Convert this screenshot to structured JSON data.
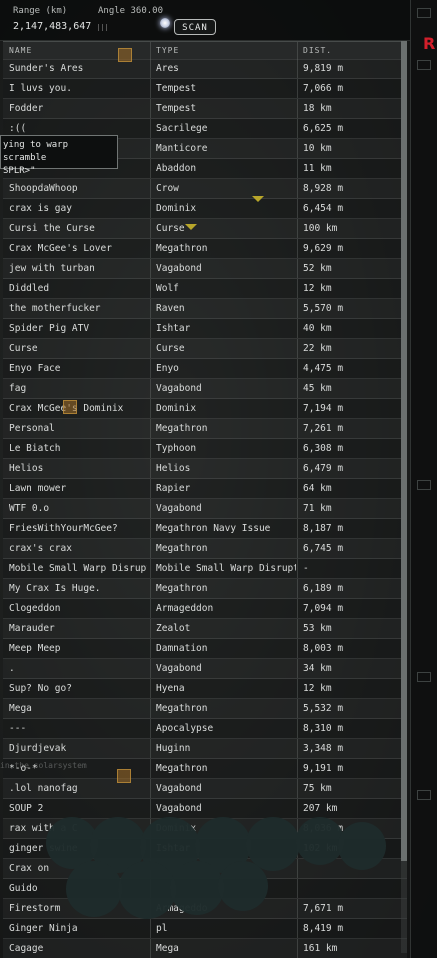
{
  "scanner": {
    "range_label": "Range (km)",
    "range_value": "2,147,483,647",
    "angle_label": "Angle 360.00",
    "scan_button": "SCAN"
  },
  "columns": {
    "name": "NAME",
    "type": "TYPE",
    "dist": "DIST."
  },
  "rows": [
    {
      "name": "Sunder's Ares",
      "type": "Ares",
      "dist": "9,819 m"
    },
    {
      "name": "I luvs you.",
      "type": "Tempest",
      "dist": "7,066 m"
    },
    {
      "name": "Fodder",
      "type": "Tempest",
      "dist": "18 km"
    },
    {
      "name": ":((",
      "type": "Sacrilege",
      "dist": "6,625 m"
    },
    {
      "name": "",
      "type": "Manticore",
      "dist": "10 km"
    },
    {
      "name": "",
      "type": "Abaddon",
      "dist": "11 km"
    },
    {
      "name": "ShoopdaWhoop",
      "type": "Crow",
      "dist": "8,928 m"
    },
    {
      "name": "crax is gay",
      "type": "Dominix",
      "dist": "6,454 m"
    },
    {
      "name": "Cursi the Curse",
      "type": "Curse",
      "dist": "100 km"
    },
    {
      "name": "Crax McGee's Lover",
      "type": "Megathron",
      "dist": "9,629 m"
    },
    {
      "name": "jew with turban",
      "type": "Vagabond",
      "dist": "52 km"
    },
    {
      "name": "Diddled",
      "type": "Wolf",
      "dist": "12 km"
    },
    {
      "name": "the motherfucker",
      "type": "Raven",
      "dist": "5,570 m"
    },
    {
      "name": "Spider Pig ATV",
      "type": "Ishtar",
      "dist": "40 km"
    },
    {
      "name": "Curse",
      "type": "Curse",
      "dist": "22 km"
    },
    {
      "name": "Enyo Face",
      "type": "Enyo",
      "dist": "4,475 m"
    },
    {
      "name": "fag",
      "type": "Vagabond",
      "dist": "45 km"
    },
    {
      "name": "Crax McGee's Dominix",
      "type": "Dominix",
      "dist": "7,194 m"
    },
    {
      "name": "Personal",
      "type": "Megathron",
      "dist": "7,261 m"
    },
    {
      "name": "Le Biatch",
      "type": "Typhoon",
      "dist": "6,308 m"
    },
    {
      "name": "Helios",
      "type": "Helios",
      "dist": "6,479 m"
    },
    {
      "name": "Lawn mower",
      "type": "Rapier",
      "dist": "64 km"
    },
    {
      "name": "WTF 0.o",
      "type": "Vagabond",
      "dist": "71 km"
    },
    {
      "name": "FriesWithYourMcGee?",
      "type": "Megathron Navy Issue",
      "dist": "8,187 m"
    },
    {
      "name": "crax's crax",
      "type": "Megathron",
      "dist": "6,745 m"
    },
    {
      "name": "Mobile Small Warp Disruptor I",
      "type": "Mobile Small Warp Disruptor I",
      "dist": "-"
    },
    {
      "name": "My Crax Is Huge.",
      "type": "Megathron",
      "dist": "6,189 m"
    },
    {
      "name": "Clogeddon",
      "type": "Armageddon",
      "dist": "7,094 m"
    },
    {
      "name": "Marauder",
      "type": "Zealot",
      "dist": "53 km"
    },
    {
      "name": "Meep Meep",
      "type": "Damnation",
      "dist": "8,003 m"
    },
    {
      "name": ".",
      "type": "Vagabond",
      "dist": "34 km"
    },
    {
      "name": "Sup? No go?",
      "type": "Hyena",
      "dist": "12 km"
    },
    {
      "name": "Mega",
      "type": "Megathron",
      "dist": "5,532 m"
    },
    {
      "name": "---",
      "type": "Apocalypse",
      "dist": "8,310 m"
    },
    {
      "name": "Djurdjevak",
      "type": "Huginn",
      "dist": "3,348 m"
    },
    {
      "name": "*-o-*",
      "type": "Megathron",
      "dist": "9,191 m"
    },
    {
      "name": ".lol nanofag",
      "type": "Vagabond",
      "dist": "75 km"
    },
    {
      "name": "SOUP 2",
      "type": "Vagabond",
      "dist": "207 km"
    },
    {
      "name": "rax with a C",
      "type": "Dominix",
      "dist": "8,036 m"
    },
    {
      "name": "ginger swine",
      "type": "Ishtar",
      "dist": "102 km"
    },
    {
      "name": "Crax on",
      "type": "",
      "dist": ""
    },
    {
      "name": "Guido",
      "type": "",
      "dist": ""
    },
    {
      "name": "Firestorm",
      "type": "Armageddo",
      "dist": "7,671 m"
    },
    {
      "name": "Ginger Ninja",
      "type": "pl",
      "dist": "8,419 m"
    },
    {
      "name": "Cagage",
      "type": "Mega",
      "dist": "161 km"
    },
    {
      "name": "***",
      "type": "Tempest",
      "dist": "5,825 m"
    },
    {
      "name": "SIMCE PAY 19 MILION",
      "type": "Crow",
      "dist": "16 km"
    }
  ],
  "tooltip": {
    "line1": "ying to warp scramble",
    "line2": "SPLR>\""
  },
  "ghost_text": "in the solarsystem",
  "logo_text": "R"
}
